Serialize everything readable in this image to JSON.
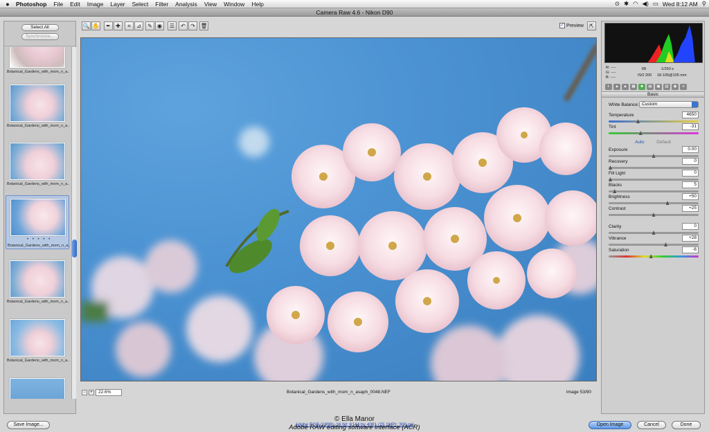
{
  "menubar": {
    "apple": "",
    "items": [
      "Photoshop",
      "File",
      "Edit",
      "Image",
      "Layer",
      "Select",
      "Filter",
      "Analysis",
      "View",
      "Window",
      "Help"
    ],
    "clock": "Wed 8:12 AM"
  },
  "window": {
    "title": "Camera Raw 4.6  -  Nikon D90"
  },
  "filmstrip": {
    "select_all": "Select All",
    "synchronize": "Synchronize...",
    "thumbs": [
      {
        "caption": "Botanical_Gardens_with_mom_n_a..."
      },
      {
        "caption": "Botanical_Gardens_with_mom_n_a..."
      },
      {
        "caption": "Botanical_Gardens_with_mom_n_a..."
      },
      {
        "caption": "Botanical_Gardens_with_mom_n_a...",
        "selected": true,
        "stars": "• • • • •"
      },
      {
        "caption": "Botanical_Gardens_with_mom_n_a..."
      },
      {
        "caption": "Botanical_Gardens_with_mom_n_a..."
      },
      {
        "caption": ""
      }
    ]
  },
  "toolbar": {
    "tools": [
      "zoom-icon",
      "hand-icon",
      "eyedropper-icon",
      "color-sampler-icon",
      "crop-icon",
      "straighten-icon",
      "retouch-icon",
      "red-eye-icon",
      "preferences-icon",
      "rotate-left-icon",
      "rotate-right-icon",
      "trash-icon"
    ],
    "tool_glyphs": [
      "🔍",
      "✋",
      "✒",
      "✚",
      "⌗",
      "⊿",
      "✎",
      "◉",
      "☰",
      "↶",
      "↷",
      "🗑"
    ],
    "preview_label": "Preview",
    "preview_checked": "✓"
  },
  "status": {
    "zoom": "22.6%",
    "filename": "Botanical_Gardens_with_mom_n_asaph_0048.NEF",
    "image_count": "Image 53/90"
  },
  "info": {
    "r": "R:   ----",
    "g": "G:   ----",
    "b": "B:   ----",
    "aperture": "f/8",
    "shutter": "1/250 s",
    "iso": "ISO 200",
    "lens": "18-105@105 mm"
  },
  "panel": {
    "title": "Basic",
    "white_balance_label": "White Balance:",
    "white_balance_value": "Custom",
    "auto": "Auto",
    "default": "Default",
    "sliders": [
      {
        "label": "Temperature",
        "value": "4650",
        "pos": 0.32
      },
      {
        "label": "Tint",
        "value": "-31",
        "pos": 0.35
      },
      {
        "label": "Exposure",
        "value": "0.00",
        "pos": 0.5
      },
      {
        "label": "Recovery",
        "value": "0",
        "pos": 0.0
      },
      {
        "label": "Fill Light",
        "value": "0",
        "pos": 0.0
      },
      {
        "label": "Blacks",
        "value": "5",
        "pos": 0.05
      },
      {
        "label": "Brightness",
        "value": "+50",
        "pos": 0.66
      },
      {
        "label": "Contrast",
        "value": "+25",
        "pos": 0.5
      },
      {
        "label": "Clarity",
        "value": "0",
        "pos": 0.5
      },
      {
        "label": "Vibrance",
        "value": "+28",
        "pos": 0.64
      },
      {
        "label": "Saturation",
        "value": "-6",
        "pos": 0.47
      }
    ]
  },
  "bottom": {
    "save": "Save Image...",
    "workflow": "Adobe RGB (1998); 16 bit; 6144 by 4081 (25.1MP); 300 ppi",
    "open": "Open Image",
    "cancel": "Cancel",
    "done": "Done"
  },
  "credit": {
    "line1": "© Ella Manor",
    "line2": "Adobe RAW editing software interface (ACR)"
  }
}
